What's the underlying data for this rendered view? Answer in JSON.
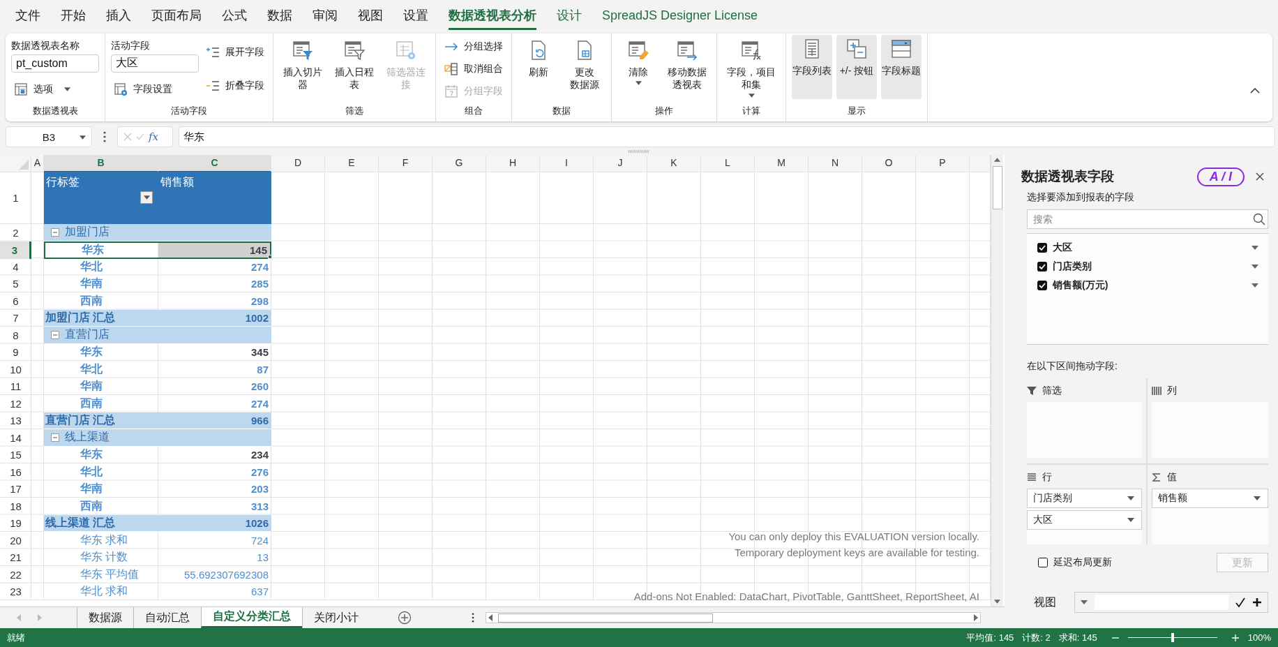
{
  "menu_tabs": [
    {
      "label": "文件",
      "selected": false,
      "contextual": false
    },
    {
      "label": "开始",
      "selected": false,
      "contextual": false
    },
    {
      "label": "插入",
      "selected": false,
      "contextual": false
    },
    {
      "label": "页面布局",
      "selected": false,
      "contextual": false
    },
    {
      "label": "公式",
      "selected": false,
      "contextual": false
    },
    {
      "label": "数据",
      "selected": false,
      "contextual": false
    },
    {
      "label": "审阅",
      "selected": false,
      "contextual": false
    },
    {
      "label": "视图",
      "selected": false,
      "contextual": false
    },
    {
      "label": "设置",
      "selected": false,
      "contextual": false
    },
    {
      "label": "数据透视表分析",
      "selected": true,
      "contextual": true
    },
    {
      "label": "设计",
      "selected": false,
      "contextual": true
    },
    {
      "label": "SpreadJS Designer License",
      "selected": false,
      "contextual": true
    }
  ],
  "ribbon": {
    "groups": [
      {
        "label": "数据透视表",
        "columns": [
          [
            {
              "kind": "field",
              "label": "数据透视表名称",
              "value": "pt_custom"
            },
            {
              "kind": "small",
              "label": "选项",
              "dropdown": true,
              "disabled": false
            }
          ]
        ]
      },
      {
        "label": "活动字段",
        "columns": [
          [
            {
              "kind": "field",
              "label": "活动字段",
              "value": "大区"
            },
            {
              "kind": "small",
              "label": "字段设置",
              "dropdown": false,
              "disabled": false
            }
          ],
          [
            {
              "kind": "small",
              "label": "展开字段",
              "dropdown": false,
              "disabled": false
            },
            {
              "kind": "small",
              "label": "折叠字段",
              "dropdown": false,
              "disabled": false
            }
          ]
        ]
      },
      {
        "label": "筛选",
        "columns": [
          [
            {
              "kind": "large",
              "lines": [
                "插入切片",
                "器"
              ],
              "dropdown": false,
              "disabled": false
            }
          ],
          [
            {
              "kind": "large",
              "lines": [
                "插入日程",
                "表"
              ],
              "dropdown": false,
              "disabled": false
            }
          ],
          [
            {
              "kind": "large",
              "lines": [
                "筛选器连",
                "接"
              ],
              "dropdown": false,
              "disabled": true
            }
          ]
        ]
      },
      {
        "label": "组合",
        "columns": [
          [
            {
              "kind": "small",
              "label": "分组选择",
              "dropdown": false,
              "disabled": false
            },
            {
              "kind": "small",
              "label": "取消组合",
              "dropdown": false,
              "disabled": false
            },
            {
              "kind": "small",
              "label": "分组字段",
              "dropdown": false,
              "disabled": true
            }
          ]
        ]
      },
      {
        "label": "数据",
        "columns": [
          [
            {
              "kind": "large",
              "lines": [
                "刷新"
              ],
              "dropdown": false,
              "disabled": false
            }
          ],
          [
            {
              "kind": "large",
              "lines": [
                "更改",
                "数据源"
              ],
              "dropdown": false,
              "disabled": false
            }
          ]
        ]
      },
      {
        "label": "操作",
        "columns": [
          [
            {
              "kind": "large",
              "lines": [
                "清除"
              ],
              "dropdown": true,
              "disabled": false
            }
          ],
          [
            {
              "kind": "large",
              "lines": [
                "移动数据",
                "透视表"
              ],
              "dropdown": false,
              "disabled": false
            }
          ]
        ]
      },
      {
        "label": "计算",
        "columns": [
          [
            {
              "kind": "large",
              "lines": [
                "字段，项目",
                "和集"
              ],
              "dropdown": true,
              "disabled": false
            }
          ]
        ]
      },
      {
        "label": "显示",
        "columns": [
          [
            {
              "kind": "toggle",
              "lines": [
                "字段列表"
              ],
              "selected": true
            }
          ],
          [
            {
              "kind": "toggle",
              "lines": [
                "+/- 按钮"
              ],
              "selected": true
            }
          ],
          [
            {
              "kind": "toggle",
              "lines": [
                "字段标题"
              ],
              "selected": true
            }
          ]
        ]
      }
    ]
  },
  "formula_bar": {
    "name_box": "B3",
    "fx_label": "fx",
    "value": "华东"
  },
  "grid": {
    "columns": [
      {
        "label": "A",
        "selected": false
      },
      {
        "label": "B",
        "selected": true
      },
      {
        "label": "C",
        "selected": true
      },
      {
        "label": "D",
        "selected": false
      },
      {
        "label": "E",
        "selected": false
      },
      {
        "label": "F",
        "selected": false
      },
      {
        "label": "G",
        "selected": false
      },
      {
        "label": "H",
        "selected": false
      },
      {
        "label": "I",
        "selected": false
      },
      {
        "label": "J",
        "selected": false
      },
      {
        "label": "K",
        "selected": false
      },
      {
        "label": "L",
        "selected": false
      },
      {
        "label": "M",
        "selected": false
      },
      {
        "label": "N",
        "selected": false
      },
      {
        "label": "O",
        "selected": false
      },
      {
        "label": "P",
        "selected": false
      }
    ],
    "rows": [
      {
        "number": "1",
        "selected": false,
        "kind": "header",
        "label": "行标签",
        "value": "销售额"
      },
      {
        "number": "2",
        "selected": false,
        "kind": "group",
        "label": "加盟门店",
        "expanded": true
      },
      {
        "number": "3",
        "selected": true,
        "kind": "item",
        "label": "华东",
        "value": "145",
        "value_emphasized": true
      },
      {
        "number": "4",
        "selected": false,
        "kind": "item",
        "label": "华北",
        "value": "274",
        "value_emphasized": false
      },
      {
        "number": "5",
        "selected": false,
        "kind": "item",
        "label": "华南",
        "value": "285",
        "value_emphasized": false
      },
      {
        "number": "6",
        "selected": false,
        "kind": "item",
        "label": "西南",
        "value": "298",
        "value_emphasized": false
      },
      {
        "number": "7",
        "selected": false,
        "kind": "subtotal",
        "label": "加盟门店 汇总",
        "value": "1002"
      },
      {
        "number": "8",
        "selected": false,
        "kind": "group",
        "label": "直营门店",
        "expanded": true
      },
      {
        "number": "9",
        "selected": false,
        "kind": "item",
        "label": "华东",
        "value": "345",
        "value_emphasized": true
      },
      {
        "number": "10",
        "selected": false,
        "kind": "item",
        "label": "华北",
        "value": "87",
        "value_emphasized": false
      },
      {
        "number": "11",
        "selected": false,
        "kind": "item",
        "label": "华南",
        "value": "260",
        "value_emphasized": false
      },
      {
        "number": "12",
        "selected": false,
        "kind": "item",
        "label": "西南",
        "value": "274",
        "value_emphasized": false
      },
      {
        "number": "13",
        "selected": false,
        "kind": "subtotal",
        "label": "直营门店 汇总",
        "value": "966"
      },
      {
        "number": "14",
        "selected": false,
        "kind": "group",
        "label": "线上渠道",
        "expanded": true
      },
      {
        "number": "15",
        "selected": false,
        "kind": "item",
        "label": "华东",
        "value": "234",
        "value_emphasized": true
      },
      {
        "number": "16",
        "selected": false,
        "kind": "item",
        "label": "华北",
        "value": "276",
        "value_emphasized": false
      },
      {
        "number": "17",
        "selected": false,
        "kind": "item",
        "label": "华南",
        "value": "203",
        "value_emphasized": false
      },
      {
        "number": "18",
        "selected": false,
        "kind": "item",
        "label": "西南",
        "value": "313",
        "value_emphasized": false
      },
      {
        "number": "19",
        "selected": false,
        "kind": "subtotal",
        "label": "线上渠道 汇总",
        "value": "1026"
      },
      {
        "number": "20",
        "selected": false,
        "kind": "detail",
        "label": "华东 求和",
        "value": "724"
      },
      {
        "number": "21",
        "selected": false,
        "kind": "detail",
        "label": "华东 计数",
        "value": "13"
      },
      {
        "number": "22",
        "selected": false,
        "kind": "detail",
        "label": "华东 平均值",
        "value": "55.692307692308"
      },
      {
        "number": "23",
        "selected": false,
        "kind": "detail",
        "label": "华北 求和",
        "value": "637"
      }
    ]
  },
  "notice": {
    "lines": [
      "You can only deploy this EVALUATION version locally.",
      "Temporary deployment keys are available for testing."
    ],
    "addons": "Add-ons Not Enabled: DataChart, PivotTable, GanttSheet, ReportSheet, AI"
  },
  "sheet_tabs": [
    {
      "label": "数据源",
      "selected": false
    },
    {
      "label": "自动汇总",
      "selected": false
    },
    {
      "label": "自定义分类汇总",
      "selected": true
    },
    {
      "label": "关闭小计",
      "selected": false
    }
  ],
  "pivot_panel": {
    "title": "数据透视表字段",
    "ai_label": "A / I",
    "subtitle": "选择要添加到报表的字段",
    "search": {
      "placeholder": "搜索"
    },
    "fields": [
      {
        "label": "大区",
        "checked": true
      },
      {
        "label": "门店类别",
        "checked": true
      },
      {
        "label": "销售额(万元)",
        "checked": true
      }
    ],
    "areas_label": "在以下区间拖动字段:",
    "areas": [
      {
        "kind": "filter",
        "label": "筛选"
      },
      {
        "kind": "columns",
        "label": "列"
      },
      {
        "kind": "rows",
        "label": "行",
        "items": [
          "门店类别",
          "大区"
        ]
      },
      {
        "kind": "values",
        "label": "值",
        "items": [
          "销售额"
        ]
      }
    ],
    "defer": {
      "label": "延迟布局更新",
      "checked": false
    },
    "update_button": {
      "label": "更新",
      "disabled": true
    },
    "view": {
      "label": "视图"
    }
  },
  "status_bar": {
    "status": "就绪",
    "average": "平均值: 145",
    "count": "计数: 2",
    "sum": "求和: 145",
    "zoom": {
      "level": 0.5
    },
    "zoom_label": "100%"
  }
}
